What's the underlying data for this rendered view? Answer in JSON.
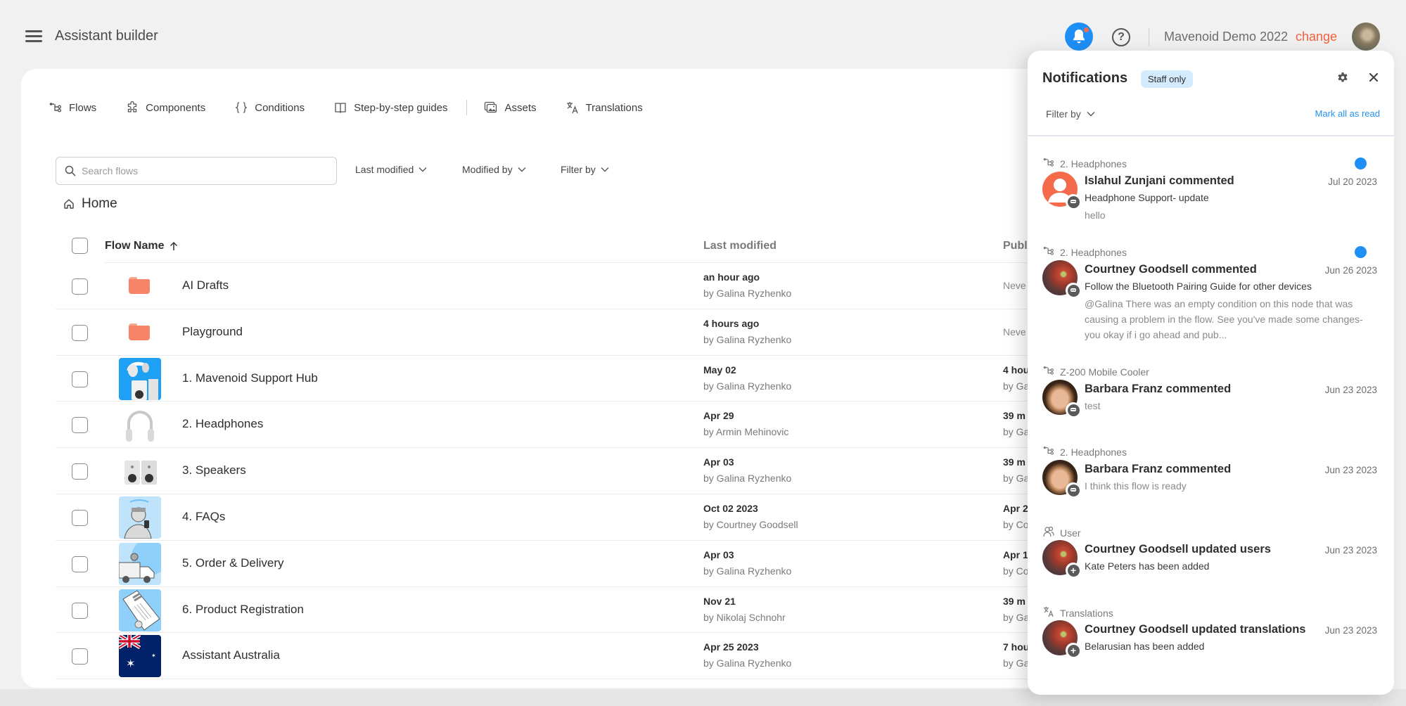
{
  "header": {
    "app_title": "Assistant builder",
    "org_name": "Mavenoid Demo 2022",
    "change_label": "change",
    "icons": {
      "menu": "hamburger-icon",
      "notifications": "bell-icon",
      "help": "help-circle-icon",
      "avatar": "user-avatar"
    },
    "colors": {
      "accent_blue": "#1e8ff5",
      "change_orange": "#f0603f"
    }
  },
  "nav": {
    "tabs": [
      {
        "label": "Flows",
        "icon": "flows-icon"
      },
      {
        "label": "Components",
        "icon": "puzzle-icon"
      },
      {
        "label": "Conditions",
        "icon": "braces-icon"
      },
      {
        "label": "Step-by-step guides",
        "icon": "book-icon"
      },
      {
        "label": "Assets",
        "icon": "images-icon"
      },
      {
        "label": "Translations",
        "icon": "translate-icon"
      }
    ]
  },
  "toolbar": {
    "search_placeholder": "Search flows",
    "search_value": "",
    "filters": [
      "Last modified",
      "Modified by",
      "Filter by"
    ]
  },
  "breadcrumb": {
    "label": "Home"
  },
  "table": {
    "columns": {
      "name": "Flow Name",
      "last_modified": "Last modified",
      "published": "Publ"
    },
    "sort": "ascending",
    "rows": [
      {
        "name": "AI Drafts",
        "type": "folder",
        "mod_when": "an hour ago",
        "mod_by": "by Galina Ryzhenko",
        "pub_when": "Neve",
        "pub_by": ""
      },
      {
        "name": "Playground",
        "type": "folder",
        "mod_when": "4 hours ago",
        "mod_by": "by Galina Ryzhenko",
        "pub_when": "Neve",
        "pub_by": ""
      },
      {
        "name": "1. Mavenoid Support Hub",
        "type": "flow",
        "thumb": "support-hub",
        "mod_when": "May 02",
        "mod_by": "by Galina Ryzhenko",
        "pub_when": "4 hou",
        "pub_by": "by Ga"
      },
      {
        "name": "2. Headphones",
        "type": "flow",
        "thumb": "headphones",
        "mod_when": "Apr 29",
        "mod_by": "by Armin Mehinovic",
        "pub_when": "39 m",
        "pub_by": "by Ga"
      },
      {
        "name": "3. Speakers",
        "type": "flow",
        "thumb": "speakers",
        "mod_when": "Apr 03",
        "mod_by": "by Galina Ryzhenko",
        "pub_when": "39 m",
        "pub_by": "by Ga"
      },
      {
        "name": "4. FAQs",
        "type": "flow",
        "thumb": "faqs",
        "mod_when": "Oct 02 2023",
        "mod_by": "by Courtney Goodsell",
        "pub_when": "Apr 2",
        "pub_by": "by Co"
      },
      {
        "name": "5. Order & Delivery",
        "type": "flow",
        "thumb": "delivery",
        "mod_when": "Apr 03",
        "mod_by": "by Galina Ryzhenko",
        "pub_when": "Apr 1",
        "pub_by": "by Co"
      },
      {
        "name": "6. Product Registration",
        "type": "flow",
        "thumb": "registration",
        "mod_when": "Nov 21",
        "mod_by": "by Nikolaj Schnohr",
        "pub_when": "39 m",
        "pub_by": "by Ga"
      },
      {
        "name": "Assistant Australia",
        "type": "flow",
        "thumb": "australia-flag",
        "mod_when": "Apr 25 2023",
        "mod_by": "by Galina Ryzhenko",
        "pub_when": "7 hou",
        "pub_by": "by Ga"
      }
    ]
  },
  "notifications": {
    "title": "Notifications",
    "badge": "Staff only",
    "filter_label": "Filter by",
    "mark_all_label": "Mark all as read",
    "items": [
      {
        "context_icon": "flows-icon",
        "context": "2. Headphones",
        "unread": true,
        "avatar": "placeholder-orange",
        "action_icon": "comment",
        "title": "Islahul Zunjani commented",
        "date": "Jul 20 2023",
        "subtitle": "Headphone Support- update",
        "body": "hello"
      },
      {
        "context_icon": "flows-icon",
        "context": "2. Headphones",
        "unread": true,
        "avatar": "courtney",
        "action_icon": "comment",
        "title": "Courtney Goodsell commented",
        "date": "Jun 26 2023",
        "subtitle": "Follow the Bluetooth Pairing Guide for other devices",
        "body": "@Galina There was an empty condition on this node that was causing a problem in the flow. See you've made some changes- you okay if i go ahead and pub..."
      },
      {
        "context_icon": "flows-icon",
        "context": "Z-200 Mobile Cooler",
        "unread": false,
        "avatar": "barbara",
        "action_icon": "comment",
        "title": "Barbara Franz commented",
        "date": "Jun 23 2023",
        "subtitle": "test",
        "body": ""
      },
      {
        "context_icon": "flows-icon",
        "context": "2. Headphones",
        "unread": false,
        "avatar": "barbara",
        "action_icon": "comment",
        "title": "Barbara Franz commented",
        "date": "Jun 23 2023",
        "subtitle": "I think this flow is ready",
        "body": ""
      },
      {
        "context_icon": "users-icon",
        "context": "User",
        "unread": false,
        "avatar": "courtney",
        "action_icon": "add",
        "title": "Courtney Goodsell updated users",
        "date": "Jun 23 2023",
        "subtitle": "Kate Peters has been added",
        "body": ""
      },
      {
        "context_icon": "translate-icon",
        "context": "Translations",
        "unread": false,
        "avatar": "courtney",
        "action_icon": "add",
        "title": "Courtney Goodsell updated translations",
        "date": "Jun 23 2023",
        "subtitle": "Belarusian has been added",
        "body": ""
      }
    ]
  }
}
